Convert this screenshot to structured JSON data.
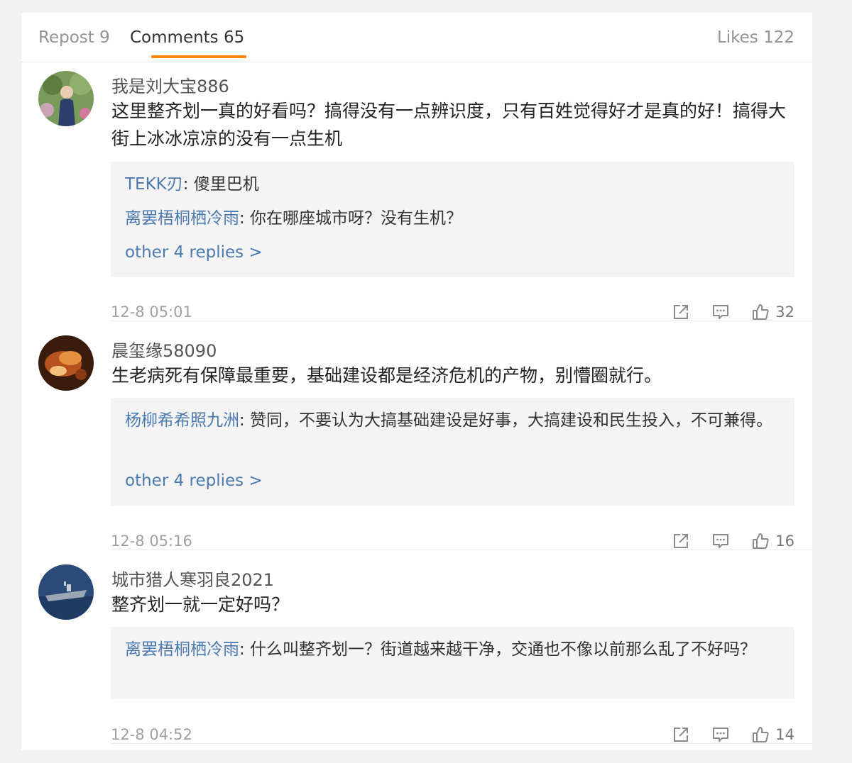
{
  "tabs": {
    "repost": "Repost 9",
    "comments": "Comments 65",
    "likes": "Likes 122"
  },
  "accent_color": "#ff8200",
  "link_color": "#4c7ab0",
  "comments": [
    {
      "username": "我是刘大宝886",
      "text": "这里整齐划一真的好看吗？搞得没有一点辨识度，只有百姓觉得好才是真的好！搞得大街上冰冰凉凉的没有一点生机",
      "replies": [
        {
          "author": "TEKK刃",
          "text": ": 傻里巴机"
        },
        {
          "author": "离罢梧桐栖冷雨",
          "text": ": 你在哪座城市呀？没有生机？"
        }
      ],
      "more": "other 4 replies >",
      "time": "12-8 05:01",
      "likes": "32"
    },
    {
      "username": "晨玺缘58090",
      "text": "生老病死有保障最重要，基础建设都是经济危机的产物，别懵圈就行。",
      "replies": [
        {
          "author": "杨柳希希照九洲",
          "text": ": 赞同，不要认为大搞基础建设是好事，大搞建设和民生投入，不可兼得。"
        }
      ],
      "more": "other 4 replies >",
      "time": "12-8 05:16",
      "likes": "16"
    },
    {
      "username": "城市猎人寒羽良2021",
      "text": "整齐划一就一定好吗？",
      "replies": [
        {
          "author": "离罢梧桐栖冷雨",
          "text": ": 什么叫整齐划一？街道越来越干净，交通也不像以前那么乱了不好吗？"
        }
      ],
      "time": "12-8 04:52",
      "likes": "14"
    }
  ]
}
